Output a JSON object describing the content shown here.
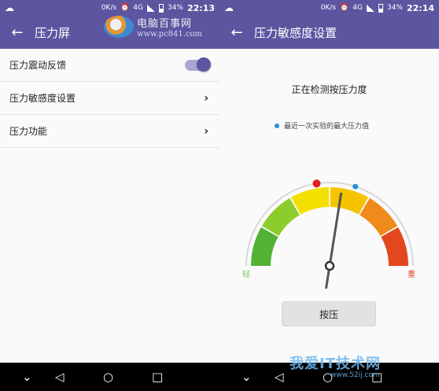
{
  "left": {
    "status": {
      "speed": "0K/s",
      "net": "4G",
      "battery": "34%",
      "time": "22:13"
    },
    "title": "压力屏",
    "watermark": {
      "name": "电脑百事网",
      "url": "www.pc841.com"
    },
    "items": [
      {
        "label": "压力震动反馈",
        "control": "toggle",
        "on": true
      },
      {
        "label": "压力敏感度设置",
        "control": "chevron"
      },
      {
        "label": "压力功能",
        "control": "chevron"
      }
    ]
  },
  "right": {
    "status": {
      "speed": "0K/s",
      "net": "4G",
      "battery": "34%",
      "time": "22:14"
    },
    "title": "压力敏感度设置",
    "detecting": "正在检测按压力度",
    "legend": "最近一次实验的最大压力值",
    "gauge": {
      "light_label": "轻",
      "heavy_label": "重",
      "segment_colors": [
        "#52b234",
        "#8ccc2c",
        "#f4e000",
        "#f6c300",
        "#f08a1a",
        "#e2471e"
      ],
      "needle_fraction": 0.55,
      "red_marker_fraction": 0.45,
      "blue_marker_fraction": 0.6
    },
    "press_button": "按压"
  },
  "navbar": {
    "icons": [
      "chevron-down-icon",
      "back-triangle-icon",
      "home-circle-icon",
      "recents-square-icon"
    ]
  },
  "watermark2": {
    "text": "我爱IT技术网",
    "url": "www.52ij.com"
  }
}
